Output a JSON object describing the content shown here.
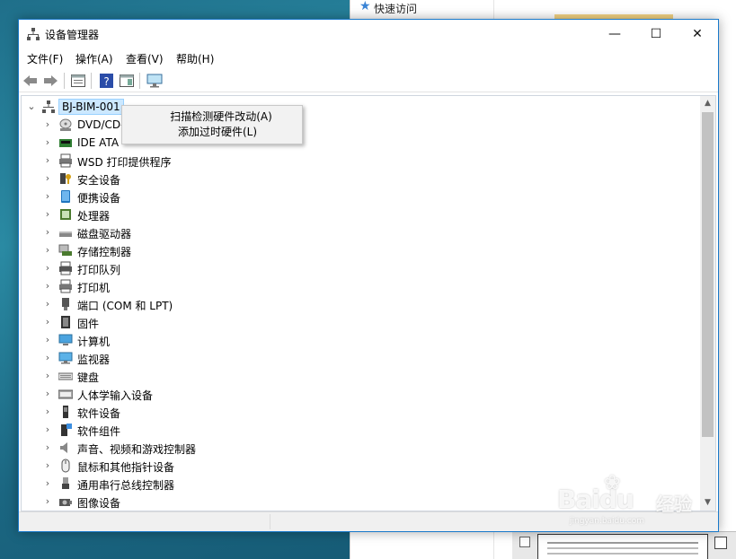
{
  "background": {
    "explorer_quick_access": "快速访问",
    "watermark": {
      "brand": "Bai",
      "brand_tail": "du",
      "jingyan": "经验",
      "url": "jingyan.baidu.com"
    }
  },
  "window": {
    "title": "设备管理器",
    "controls": {
      "minimize": "—",
      "maximize": "☐",
      "close": "✕"
    },
    "menu": [
      "文件(F)",
      "操作(A)",
      "查看(V)",
      "帮助(H)"
    ],
    "toolbar": [
      "back",
      "forward",
      "properties",
      "help",
      "view",
      "monitor"
    ]
  },
  "tree": {
    "root": {
      "label": "BJ-BIM-001",
      "expanded": true
    },
    "items": [
      {
        "label": "DVD/CD-",
        "icon": "dvd-drive-icon"
      },
      {
        "label": "IDE ATA",
        "icon": "ide-controller-icon"
      },
      {
        "label": "WSD 打印提供程序",
        "icon": "printer-icon"
      },
      {
        "label": "安全设备",
        "icon": "security-key-icon"
      },
      {
        "label": "便携设备",
        "icon": "portable-device-icon"
      },
      {
        "label": "处理器",
        "icon": "processor-icon"
      },
      {
        "label": "磁盘驱动器",
        "icon": "disk-drive-icon"
      },
      {
        "label": "存储控制器",
        "icon": "storage-controller-icon"
      },
      {
        "label": "打印队列",
        "icon": "print-queue-icon"
      },
      {
        "label": "打印机",
        "icon": "printer-icon"
      },
      {
        "label": "端口 (COM 和 LPT)",
        "icon": "port-icon"
      },
      {
        "label": "固件",
        "icon": "firmware-icon"
      },
      {
        "label": "计算机",
        "icon": "computer-icon"
      },
      {
        "label": "监视器",
        "icon": "monitor-icon"
      },
      {
        "label": "键盘",
        "icon": "keyboard-icon"
      },
      {
        "label": "人体学输入设备",
        "icon": "hid-icon"
      },
      {
        "label": "软件设备",
        "icon": "software-device-icon"
      },
      {
        "label": "软件组件",
        "icon": "software-component-icon"
      },
      {
        "label": "声音、视频和游戏控制器",
        "icon": "speaker-icon"
      },
      {
        "label": "鼠标和其他指针设备",
        "icon": "mouse-icon"
      },
      {
        "label": "通用串行总线控制器",
        "icon": "usb-icon"
      },
      {
        "label": "图像设备",
        "icon": "camera-icon"
      }
    ]
  },
  "context_menu": {
    "items": [
      "扫描检测硬件改动(A)",
      "添加过时硬件(L)"
    ]
  },
  "colors": {
    "accent_border": "#1979ca",
    "selection": "#cce8ff",
    "desktop": "#1f6f8a"
  }
}
